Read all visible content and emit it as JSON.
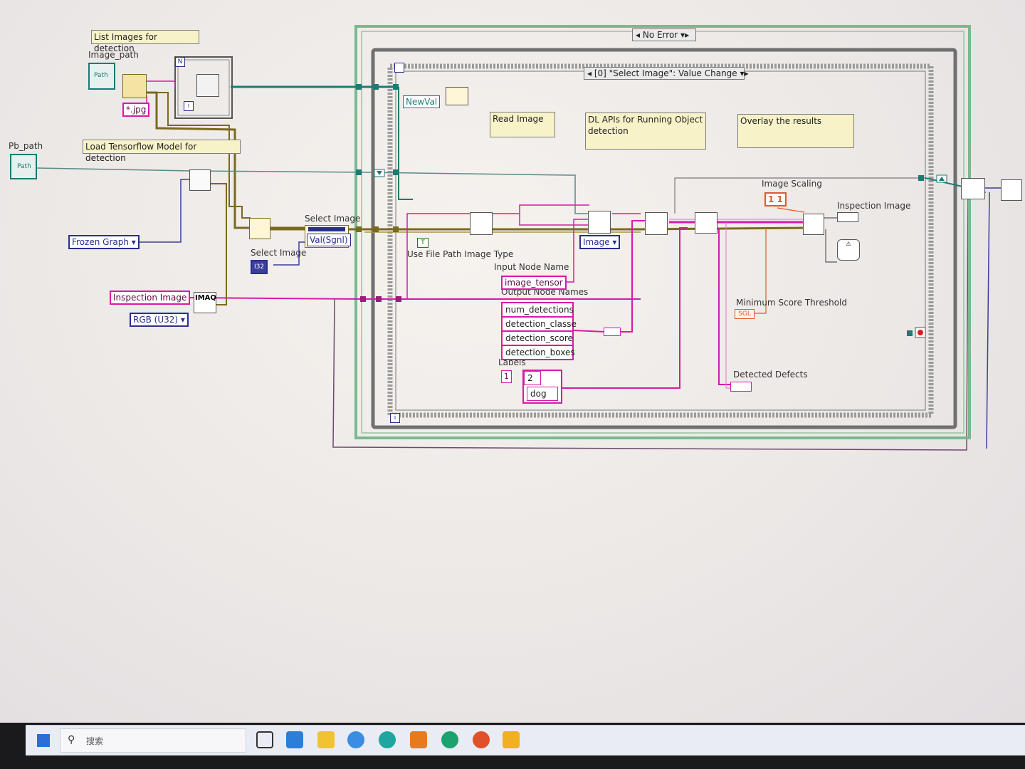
{
  "comments": {
    "list_images": "List Images for detection",
    "load_model": "Load Tensorflow Model for detection",
    "read_image": "Read Image",
    "dl_apis": "DL APIs for Running Object detection",
    "overlay": "Overlay the results"
  },
  "labels": {
    "image_path": "Image_path",
    "pb_path": "Pb_path",
    "select_image_top": "Select Image",
    "select_image_left": "Select Image",
    "use_file_path": "Use File Path Image Type",
    "input_node_name": "Input Node Name",
    "output_node_names": "Output Node Names",
    "labels": "Labels",
    "image_scaling": "Image Scaling",
    "inspection_image_out": "Inspection Image",
    "min_score": "Minimum Score Threshold",
    "detected_defects": "Detected Defects"
  },
  "controls": {
    "jpg_pattern": "*.jpg",
    "frozen_graph": "Frozen Graph",
    "inspection_image": "Inspection Image",
    "imaq": "IMAQ",
    "rgb_type": "RGB (U32)",
    "i32": "I32",
    "val_sgnl": "Val(Sgnl)",
    "newval": "NewVal",
    "image_enum": "Image",
    "input_node_value": "image_tensor",
    "output_nodes": [
      "num_detections",
      "detection_classe",
      "detection_score",
      "detection_boxes"
    ],
    "label_index_outer": "1",
    "label_index_inner": "2",
    "label_value": "dog",
    "scaling_value": "1 1",
    "sgl": "SGL",
    "path_icon": "Path",
    "loop_n": "N",
    "loop_i": "i",
    "bool_t": "T"
  },
  "structures": {
    "case_selector": "No Error",
    "event_selector": "[0] \"Select Image\": Value Change"
  },
  "taskbar": {
    "search_placeholder": "搜索"
  },
  "colors": {
    "wire_pink": "#d81aa8",
    "wire_olive": "#7a6a1e",
    "wire_teal": "#1c7a74",
    "wire_blue": "#3b3f9a",
    "case_green": "#79b98f",
    "comment_yellow": "#f8f2c8"
  }
}
